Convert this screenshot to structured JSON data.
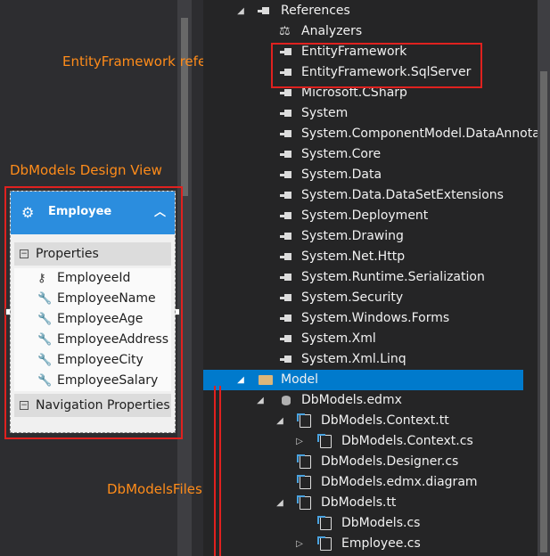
{
  "annotations": {
    "ef_references": "EntityFramework references",
    "design_view": "DbModels Design View",
    "files": "DbModelsFiles"
  },
  "entity": {
    "name": "Employee",
    "properties_header": "Properties",
    "properties": [
      "EmployeeId",
      "EmployeeName",
      "EmployeeAge",
      "EmployeeAddress",
      "EmployeeCity",
      "EmployeeSalary"
    ],
    "navigation_header": "Navigation Properties"
  },
  "tree": {
    "references": "References",
    "analyzers": "Analyzers",
    "refs": [
      "EntityFramework",
      "EntityFramework.SqlServer",
      "Microsoft.CSharp",
      "System",
      "System.ComponentModel.DataAnnota",
      "System.Core",
      "System.Data",
      "System.Data.DataSetExtensions",
      "System.Deployment",
      "System.Drawing",
      "System.Net.Http",
      "System.Runtime.Serialization",
      "System.Security",
      "System.Windows.Forms",
      "System.Xml",
      "System.Xml.Linq"
    ],
    "model_folder": "Model",
    "edmx": "DbModels.edmx",
    "context_tt": "DbModels.Context.tt",
    "context_cs": "DbModels.Context.cs",
    "designer_cs": "DbModels.Designer.cs",
    "edmx_diagram": "DbModels.edmx.diagram",
    "models_tt": "DbModels.tt",
    "models_cs": "DbModels.cs",
    "employee_cs": "Employee.cs"
  },
  "colors": {
    "accent": "#007acc",
    "annotation": "#ff8c1a",
    "highlight": "#e0211f",
    "entity_header": "#2b8dde"
  }
}
